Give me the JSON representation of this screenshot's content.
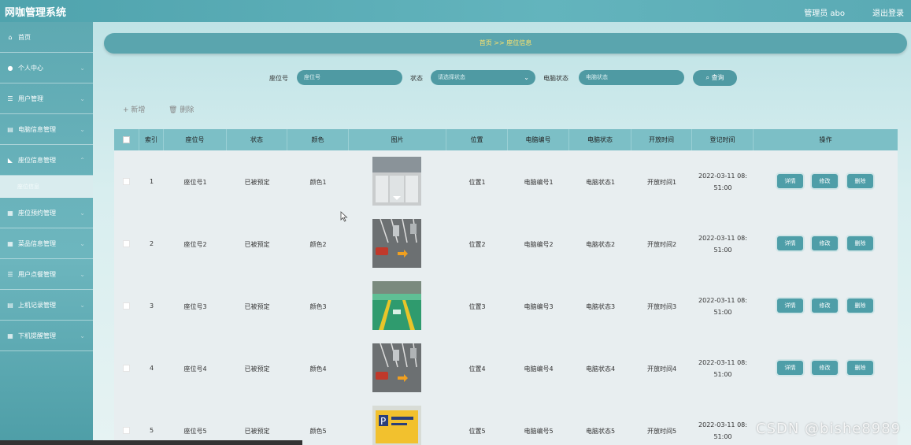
{
  "app": {
    "title": "网咖管理系统",
    "user": "管理员 abo",
    "logout": "退出登录"
  },
  "sidebar": {
    "items": [
      {
        "label": "首页",
        "icon": "home-icon"
      },
      {
        "label": "个人中心",
        "icon": "person-icon"
      },
      {
        "label": "用户管理",
        "icon": "list-icon"
      },
      {
        "label": "电脑信息管理",
        "icon": "doc-icon"
      },
      {
        "label": "座位信息管理",
        "icon": "thumb-icon"
      },
      {
        "label": "座位预约管理",
        "icon": "grid-icon"
      },
      {
        "label": "菜品信息管理",
        "icon": "grid-icon"
      },
      {
        "label": "用户点餐管理",
        "icon": "list-icon"
      },
      {
        "label": "上机记录管理",
        "icon": "doc-icon"
      },
      {
        "label": "下机提醒管理",
        "icon": "grid-icon"
      }
    ],
    "sub_item": "座位信息"
  },
  "breadcrumb": "首页 >> 座位信息",
  "search": {
    "seat_label": "座位号",
    "seat_placeholder": "座位号",
    "status_label": "状态",
    "status_placeholder": "请选择状态",
    "pc_status_label": "电脑状态",
    "pc_status_placeholder": "电脑状态",
    "query_button": "查询"
  },
  "actions": {
    "add": "新增",
    "delete": "删除"
  },
  "table": {
    "headers": [
      "索引",
      "座位号",
      "状态",
      "颜色",
      "图片",
      "位置",
      "电脑编号",
      "电脑状态",
      "开放时间",
      "登记时间",
      "操作"
    ],
    "rows": [
      {
        "index": "1",
        "seat": "座位号1",
        "status": "已被预定",
        "color": "颜色1",
        "pos": "位置1",
        "pc_no": "电脑编号1",
        "pc_status": "电脑状态1",
        "open": "开放时间1",
        "time1": "2022-03-11 08:",
        "time2": "51:00",
        "img": "room"
      },
      {
        "index": "2",
        "seat": "座位号2",
        "status": "已被预定",
        "color": "颜色2",
        "pos": "位置2",
        "pc_no": "电脑编号2",
        "pc_status": "电脑状态2",
        "open": "开放时间2",
        "time1": "2022-03-11 08:",
        "time2": "51:00",
        "img": "parking"
      },
      {
        "index": "3",
        "seat": "座位号3",
        "status": "已被预定",
        "color": "颜色3",
        "pos": "位置3",
        "pc_no": "电脑编号3",
        "pc_status": "电脑状态3",
        "open": "开放时间3",
        "time1": "2022-03-11 08:",
        "time2": "51:00",
        "img": "green"
      },
      {
        "index": "4",
        "seat": "座位号4",
        "status": "已被预定",
        "color": "颜色4",
        "pos": "位置4",
        "pc_no": "电脑编号4",
        "pc_status": "电脑状态4",
        "open": "开放时间4",
        "time1": "2022-03-11 08:",
        "time2": "51:00",
        "img": "parking"
      },
      {
        "index": "5",
        "seat": "座位号5",
        "status": "已被预定",
        "color": "颜色5",
        "pos": "位置5",
        "pc_no": "电脑编号5",
        "pc_status": "电脑状态5",
        "open": "开放时间5",
        "time1": "2022-03-11 08:",
        "time2": "51:00",
        "img": "sign"
      }
    ],
    "buttons": {
      "detail": "详情",
      "edit": "修改",
      "delete": "删除"
    }
  },
  "watermark": "CSDN @bishe8989"
}
